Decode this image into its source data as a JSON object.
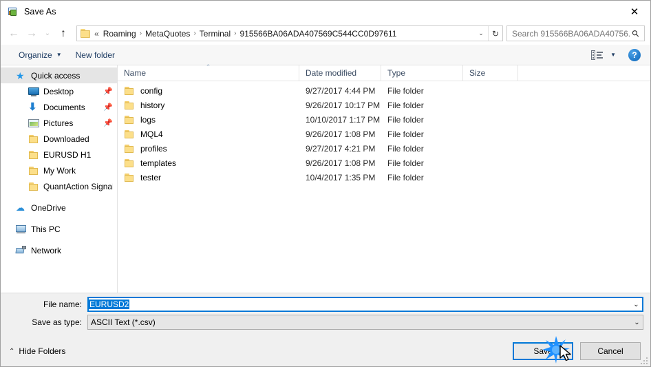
{
  "window": {
    "title": "Save As",
    "icon": "save-as-app-icon",
    "close_label": "✕"
  },
  "nav": {
    "back": "←",
    "forward": "→",
    "recent": "⌄",
    "up": "↑",
    "refresh": "↻",
    "dropdown": "⌄"
  },
  "address": {
    "overflow": "«",
    "separator": "›",
    "crumbs": [
      "Roaming",
      "MetaQuotes",
      "Terminal",
      "915566BA06ADA407569C544CC0D97611"
    ]
  },
  "search": {
    "placeholder": "Search 915566BA06ADA40756...",
    "icon": "search-icon"
  },
  "toolbar": {
    "organize": "Organize",
    "organize_caret": "▼",
    "new_folder": "New folder",
    "view_caret": "▼",
    "help": "?"
  },
  "sidebar": {
    "items": [
      {
        "label": "Quick access",
        "icon": "star-icon",
        "level": "root",
        "selected": true,
        "pinned": false
      },
      {
        "label": "Desktop",
        "icon": "monitor-icon",
        "level": "child",
        "selected": false,
        "pinned": true
      },
      {
        "label": "Documents",
        "icon": "download-icon",
        "level": "child",
        "selected": false,
        "pinned": true
      },
      {
        "label": "Pictures",
        "icon": "picture-icon",
        "level": "child",
        "selected": false,
        "pinned": true
      },
      {
        "label": "Downloaded",
        "icon": "folder-icon",
        "level": "child",
        "selected": false,
        "pinned": false
      },
      {
        "label": "EURUSD H1",
        "icon": "folder-icon",
        "level": "child",
        "selected": false,
        "pinned": false
      },
      {
        "label": "My Work",
        "icon": "folder-icon",
        "level": "child",
        "selected": false,
        "pinned": false
      },
      {
        "label": "QuantAction Signal",
        "icon": "folder-icon",
        "level": "child",
        "selected": false,
        "pinned": false
      },
      {
        "label": "OneDrive",
        "icon": "cloud-icon",
        "level": "root",
        "selected": false,
        "pinned": false
      },
      {
        "label": "This PC",
        "icon": "pc-icon",
        "level": "root",
        "selected": false,
        "pinned": false
      },
      {
        "label": "Network",
        "icon": "network-icon",
        "level": "root",
        "selected": false,
        "pinned": false
      }
    ]
  },
  "filelist": {
    "columns": [
      "Name",
      "Date modified",
      "Type",
      "Size"
    ],
    "sort_column": "Name",
    "sort_mark": "⌃",
    "rows": [
      {
        "name": "config",
        "date": "9/27/2017 4:44 PM",
        "type": "File folder",
        "size": ""
      },
      {
        "name": "history",
        "date": "9/26/2017 10:17 PM",
        "type": "File folder",
        "size": ""
      },
      {
        "name": "logs",
        "date": "10/10/2017 1:17 PM",
        "type": "File folder",
        "size": ""
      },
      {
        "name": "MQL4",
        "date": "9/26/2017 1:08 PM",
        "type": "File folder",
        "size": ""
      },
      {
        "name": "profiles",
        "date": "9/27/2017 4:21 PM",
        "type": "File folder",
        "size": ""
      },
      {
        "name": "templates",
        "date": "9/26/2017 1:08 PM",
        "type": "File folder",
        "size": ""
      },
      {
        "name": "tester",
        "date": "10/4/2017 1:35 PM",
        "type": "File folder",
        "size": ""
      }
    ]
  },
  "form": {
    "filename_label": "File name:",
    "filename_value": "EURUSD2",
    "filetype_label": "Save as type:",
    "filetype_value": "ASCII Text (*.csv)",
    "chevron": "⌄"
  },
  "footer": {
    "hide_folders": "Hide Folders",
    "hide_folders_chevron": "⌃",
    "save": "Save",
    "cancel": "Cancel"
  },
  "colors": {
    "accent": "#0078d7",
    "selection": "#0078d7",
    "link": "#1e3c63",
    "folder": "#fcdf8a"
  }
}
